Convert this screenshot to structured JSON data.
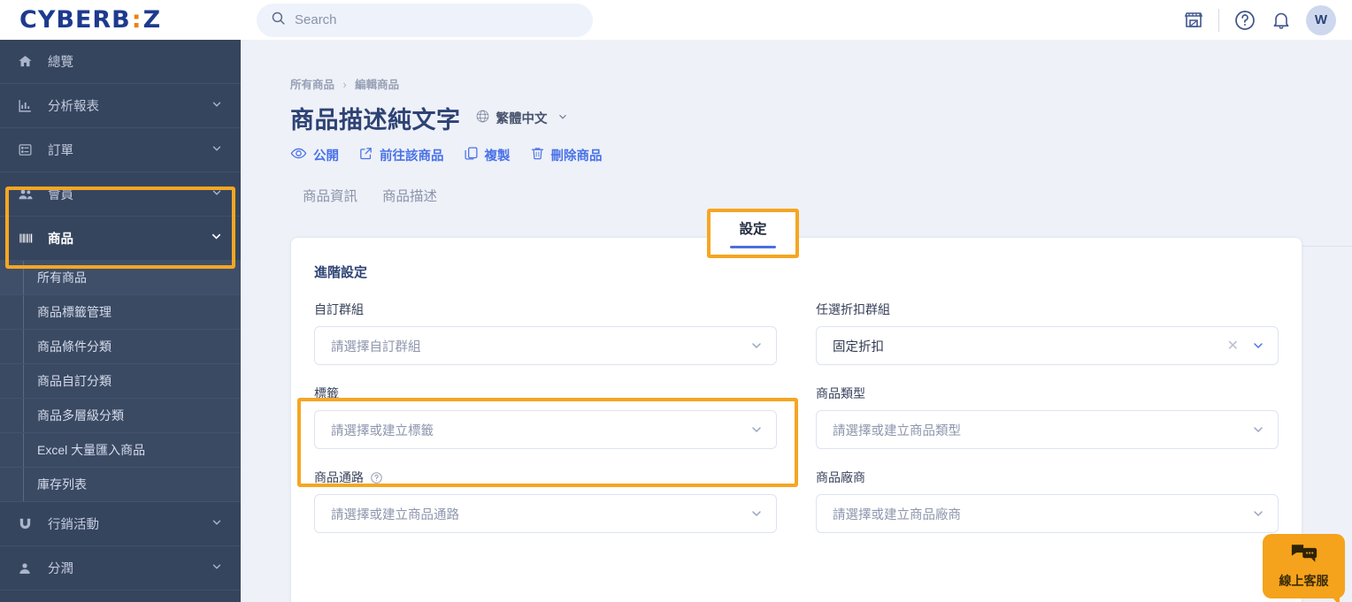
{
  "brand": {
    "name_a": "CYBERB",
    "colon": ":",
    "name_b": "Z"
  },
  "topbar": {
    "search_placeholder": "Search",
    "store_icon": "storefront-icon",
    "help_icon": "question-circle-icon",
    "bell_icon": "bell-icon",
    "avatar_initial": "W"
  },
  "sidebar": {
    "items": [
      {
        "label": "總覽",
        "icon": "home-icon",
        "expandable": false
      },
      {
        "label": "分析報表",
        "icon": "bar-chart-icon",
        "expandable": true
      },
      {
        "label": "訂單",
        "icon": "list-icon",
        "expandable": true
      },
      {
        "label": "會員",
        "icon": "users-icon",
        "expandable": true
      },
      {
        "label": "商品",
        "icon": "barcode-icon",
        "expandable": true,
        "active": true
      }
    ],
    "sub_items": [
      {
        "label": "所有商品",
        "selected": true
      },
      {
        "label": "商品標籤管理"
      },
      {
        "label": "商品條件分類"
      },
      {
        "label": "商品自訂分類"
      },
      {
        "label": "商品多層級分類"
      },
      {
        "label": "Excel 大量匯入商品"
      },
      {
        "label": "庫存列表"
      }
    ],
    "items_after": [
      {
        "label": "行銷活動",
        "icon": "magnet-icon",
        "expandable": true
      },
      {
        "label": "分潤",
        "icon": "person-icon",
        "expandable": true
      }
    ]
  },
  "breadcrumb": {
    "parent": "所有商品",
    "separator": "›",
    "current": "編輯商品"
  },
  "page": {
    "title": "商品描述純文字",
    "language": "繁體中文",
    "actions": [
      {
        "label": "公開",
        "icon": "eye-icon"
      },
      {
        "label": "前往該商品",
        "icon": "external-link-icon"
      },
      {
        "label": "複製",
        "icon": "copy-icon"
      },
      {
        "label": "刪除商品",
        "icon": "trash-icon"
      }
    ],
    "tabs": [
      {
        "label": "商品資訊",
        "active": false
      },
      {
        "label": "商品描述",
        "active": false
      },
      {
        "label": "設定",
        "active": true
      }
    ]
  },
  "card": {
    "title": "進階設定",
    "fields": [
      {
        "label": "自訂群組",
        "value": "請選擇自訂群組",
        "filled": false,
        "clearable": false,
        "help": false
      },
      {
        "label": "任選折扣群組",
        "value": "固定折扣",
        "filled": true,
        "clearable": true,
        "help": false
      },
      {
        "label": "標籤",
        "value": "請選擇或建立標籤",
        "filled": false,
        "clearable": false,
        "help": false
      },
      {
        "label": "商品類型",
        "value": "請選擇或建立商品類型",
        "filled": false,
        "clearable": false,
        "help": false
      },
      {
        "label": "商品通路",
        "value": "請選擇或建立商品通路",
        "filled": false,
        "clearable": false,
        "help": true
      },
      {
        "label": "商品廠商",
        "value": "請選擇或建立商品廠商",
        "filled": false,
        "clearable": false,
        "help": false
      }
    ],
    "clear_glyph": "✕"
  },
  "chat_widget": {
    "label": "線上客服",
    "icon": "chat-bubbles-icon"
  },
  "colors": {
    "sidebar_bg": "#36455e",
    "content_bg": "#eef1f8",
    "brand_blue": "#1d3a8f",
    "brand_orange": "#f08010",
    "highlight": "#f5a623",
    "link_blue": "#4a72e8",
    "tab_underline": "#4b6fe0",
    "chat_bg": "#f5a21c"
  }
}
